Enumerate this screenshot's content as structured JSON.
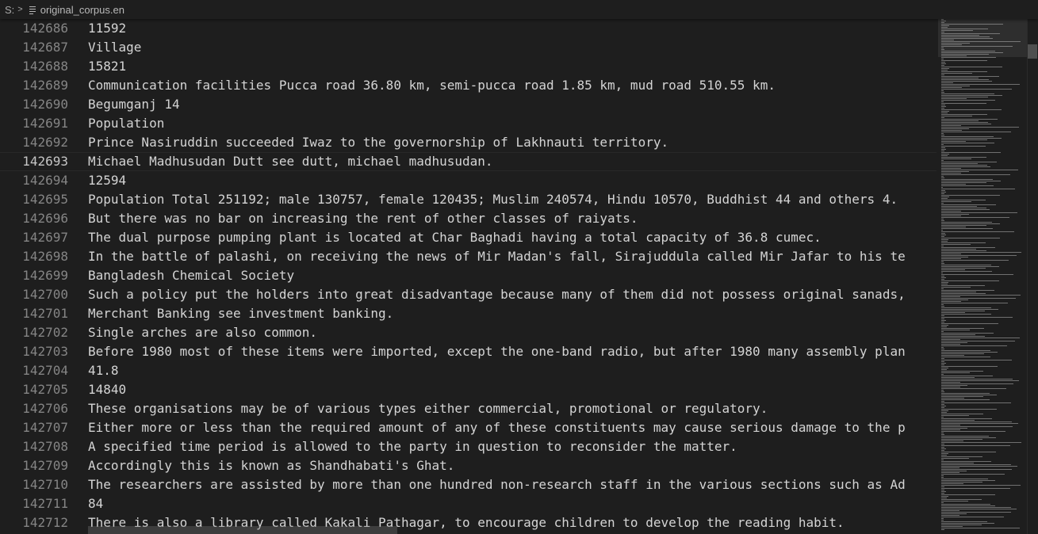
{
  "breadcrumb": {
    "drive": "S:",
    "separator": ">",
    "file_icon": "file-lines-icon",
    "file_name": "original_corpus.en"
  },
  "editor": {
    "current_line": "142693",
    "lines": [
      {
        "num": "142686",
        "text": "11592"
      },
      {
        "num": "142687",
        "text": "Village"
      },
      {
        "num": "142688",
        "text": "15821"
      },
      {
        "num": "142689",
        "text": "Communication facilities Pucca road 36.80 km, semi-pucca road 1.85 km, mud road 510.55 km."
      },
      {
        "num": "142690",
        "text": "Begumganj 14"
      },
      {
        "num": "142691",
        "text": "Population"
      },
      {
        "num": "142692",
        "text": "Prince Nasiruddin succeeded Iwaz to the governorship of Lakhnauti territory."
      },
      {
        "num": "142693",
        "text": "Michael Madhusudan Dutt see dutt, michael madhusudan."
      },
      {
        "num": "142694",
        "text": "12594"
      },
      {
        "num": "142695",
        "text": "Population Total 251192; male 130757, female 120435; Muslim 240574, Hindu 10570, Buddhist 44 and others 4."
      },
      {
        "num": "142696",
        "text": "But there was no bar on increasing the rent of other classes of raiyats."
      },
      {
        "num": "142697",
        "text": "The dual purpose pumping plant is located at Char Baghadi having a total capacity of 36.8 cumec."
      },
      {
        "num": "142698",
        "text": "In the battle of palashi, on receiving the news of Mir Madan's fall, Sirajuddula called Mir Jafar to his te"
      },
      {
        "num": "142699",
        "text": "Bangladesh Chemical Society"
      },
      {
        "num": "142700",
        "text": "Such a policy put the holders into great disadvantage because many of them did not possess original sanads,"
      },
      {
        "num": "142701",
        "text": "Merchant Banking see investment banking."
      },
      {
        "num": "142702",
        "text": "Single arches are also common."
      },
      {
        "num": "142703",
        "text": "Before 1980 most of these items were imported, except the one-band radio, but after 1980 many assembly plan"
      },
      {
        "num": "142704",
        "text": "41.8"
      },
      {
        "num": "142705",
        "text": "14840"
      },
      {
        "num": "142706",
        "text": "These organisations may be of various types either commercial, promotional or regulatory."
      },
      {
        "num": "142707",
        "text": "Either more or less than the required amount of any of these constituents may cause serious damage to the p"
      },
      {
        "num": "142708",
        "text": "A specified time period is allowed to the party in question to reconsider the matter."
      },
      {
        "num": "142709",
        "text": "Accordingly this is known as Shandhabati's Ghat."
      },
      {
        "num": "142710",
        "text": "The researchers are assisted by more than one hundred non-research staff in the various sections such as Ad"
      },
      {
        "num": "142711",
        "text": "84"
      },
      {
        "num": "142712",
        "text": "There is also a library called Kakali Pathagar, to encourage children to develop the reading habit."
      }
    ]
  }
}
